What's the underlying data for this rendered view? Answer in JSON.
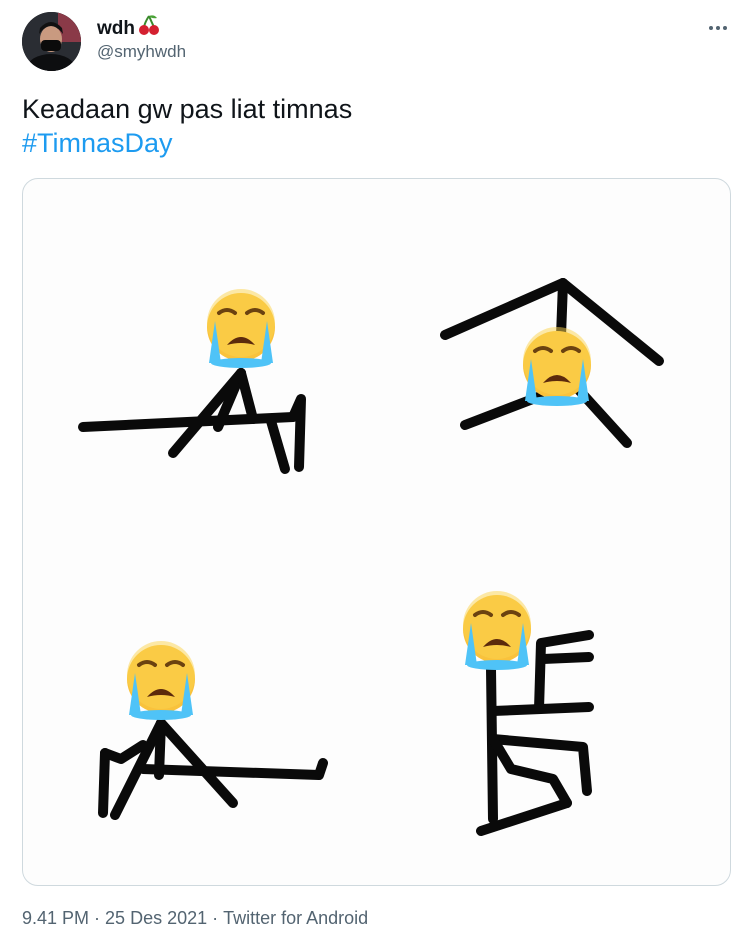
{
  "author": {
    "display_name": "wdh",
    "name_emoji": "cherry",
    "handle": "@smyhwdh",
    "avatar": "profile-photo"
  },
  "tweet": {
    "text": "Keadaan gw pas liat timnas",
    "hashtag": "#TimnasDay"
  },
  "media": {
    "panel_emoji": [
      "loudly-crying-face",
      "loudly-crying-face",
      "loudly-crying-face",
      "loudly-crying-face"
    ]
  },
  "meta": {
    "time": "9.41 PM",
    "date": "25 Des 2021",
    "separator": "·",
    "source": "Twitter for Android"
  },
  "colors": {
    "text": "#0f1419",
    "secondary": "#536471",
    "link": "#1d9bf0",
    "border": "#cfd9de"
  }
}
